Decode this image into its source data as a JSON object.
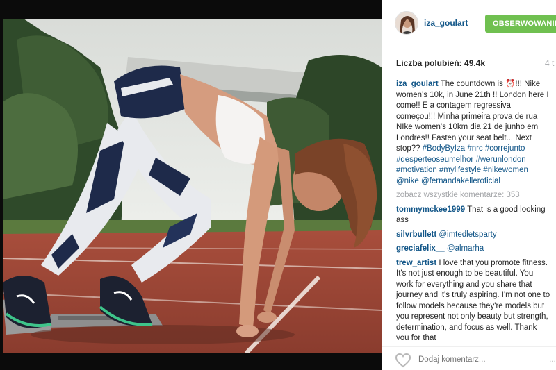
{
  "post": {
    "username": "iza_goulart",
    "follow_label": "OBSERWOWANIE",
    "likes_label": "Liczba polubień:",
    "likes_count": "49.4k",
    "time_ago": "4 t",
    "view_all": "zobacz wszystkie komentarze: 353",
    "add_comment_placeholder": "Dodaj komentarz...",
    "more_label": "..."
  },
  "caption": {
    "author": "iza_goulart",
    "text_1": "The countdown is ",
    "emoji": "⏰",
    "text_2": "!!! Nike women's 10k, in June 21th !! London here I come!! E a contagem regressiva começou!!! Minha primeira prova de rua NIke women's 10km dia 21 de junho em Londres!! Fasten your seat belt... Next stop?? ",
    "tags": [
      "#BodyByIza",
      "#nrc",
      "#correjunto",
      "#desperteoseumelhor",
      "#werunlondon",
      "#motivation",
      "#mylifestyle",
      "#nikewomen",
      "@nike",
      "@fernandakelleroficial"
    ]
  },
  "comments": [
    {
      "author": "tommymckee1999",
      "text": "That is a good looking ass"
    },
    {
      "author": "silvrbullett",
      "mention": "@imtedletsparty"
    },
    {
      "author": "greciafelix__",
      "mention": "@almarha"
    },
    {
      "author": "trew_artist",
      "text": "I love that you promote fitness. It's not just enough to be beautiful. You work for everything and you share that journey and it's truly aspiring. I'm not one to follow models because they're models but you represent not only beauty but strength, determination, and focus as well. Thank you for that"
    }
  ],
  "colors": {
    "link": "#125688",
    "follow": "#70c050",
    "muted": "#a5a7aa",
    "track": "#b5553f"
  }
}
